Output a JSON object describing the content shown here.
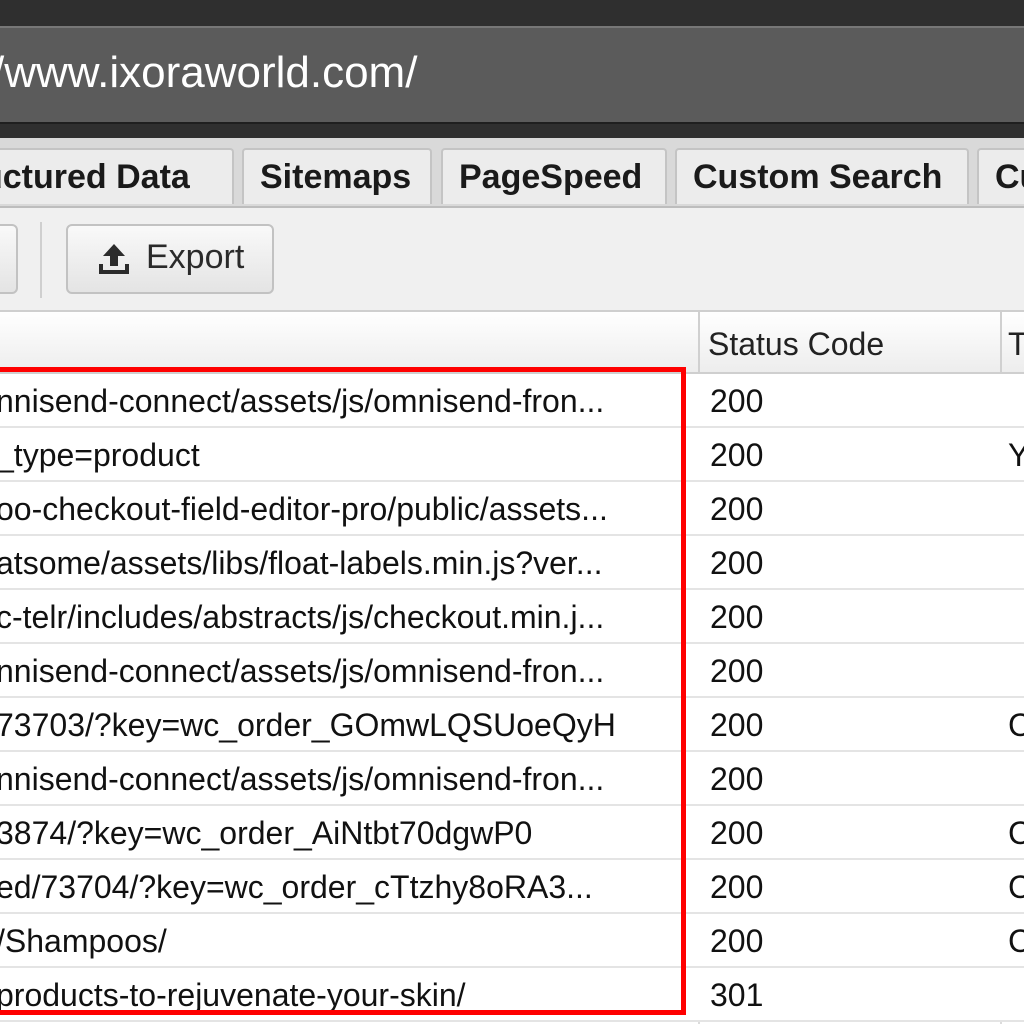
{
  "address_bar": {
    "url": "/www.ixoraworld.com/"
  },
  "tabs": [
    {
      "label": "uctured Data"
    },
    {
      "label": "Sitemaps"
    },
    {
      "label": "PageSpeed"
    },
    {
      "label": "Custom Search"
    },
    {
      "label": "Cu"
    }
  ],
  "toolbar": {
    "export_label": "Export",
    "export_icon": "upload-tray-icon"
  },
  "table": {
    "headers": {
      "status_code": "Status Code",
      "truncated": "T"
    },
    "rows": [
      {
        "address": "nnisend-connect/assets/js/omnisend-fron...",
        "status": "200",
        "extra": ""
      },
      {
        "address": "_type=product",
        "status": "200",
        "extra": "Y"
      },
      {
        "address": "oo-checkout-field-editor-pro/public/assets...",
        "status": "200",
        "extra": ""
      },
      {
        "address": "atsome/assets/libs/float-labels.min.js?ver...",
        "status": "200",
        "extra": ""
      },
      {
        "address": "c-telr/includes/abstracts/js/checkout.min.j...",
        "status": "200",
        "extra": ""
      },
      {
        "address": "nnisend-connect/assets/js/omnisend-fron...",
        "status": "200",
        "extra": ""
      },
      {
        "address": "73703/?key=wc_order_GOmwLQSUoeQyH",
        "status": "200",
        "extra": "C"
      },
      {
        "address": "nnisend-connect/assets/js/omnisend-fron...",
        "status": "200",
        "extra": ""
      },
      {
        "address": "3874/?key=wc_order_AiNtbt70dgwP0",
        "status": "200",
        "extra": "C"
      },
      {
        "address": "ed/73704/?key=wc_order_cTtzhy8oRA3...",
        "status": "200",
        "extra": "C"
      },
      {
        "address": "/Shampoos/",
        "status": "200",
        "extra": "C"
      },
      {
        "address": "products-to-rejuvenate-your-skin/",
        "status": "301",
        "extra": ""
      }
    ]
  },
  "colors": {
    "highlight": "#ff0000",
    "frame": "#2f2f2f",
    "url_bar": "#5b5b5b"
  }
}
